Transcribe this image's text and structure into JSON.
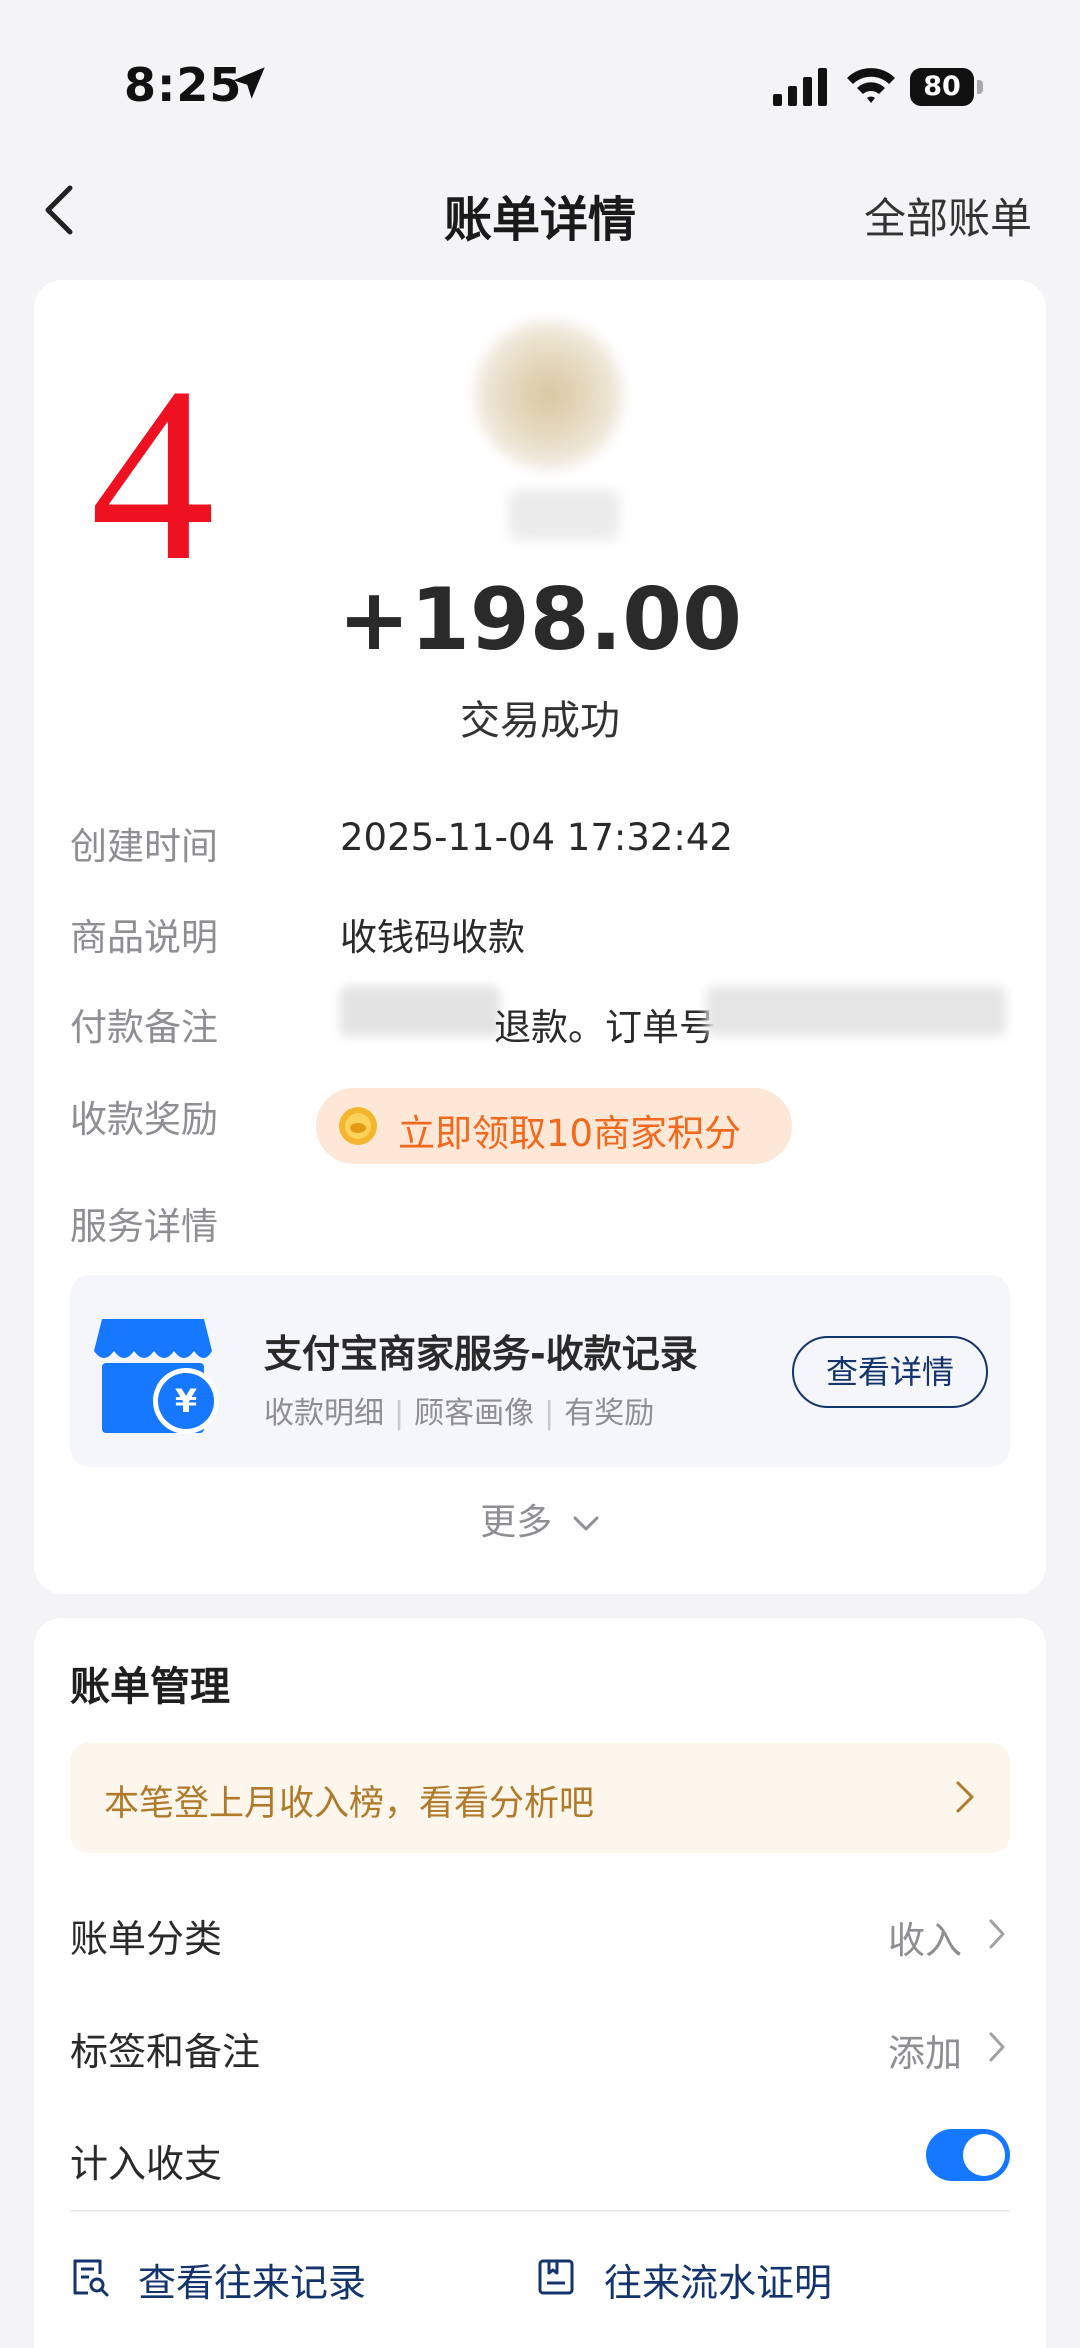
{
  "status_bar": {
    "time": "8:25",
    "battery": "80",
    "icons": [
      "location-arrow-icon",
      "cellular-signal-icon",
      "wifi-icon",
      "battery-icon"
    ]
  },
  "nav": {
    "title": "账单详情",
    "right_link": "全部账单",
    "back_icon": "chevron-left-icon"
  },
  "overlay_number": "4",
  "transaction": {
    "amount": "+198.00",
    "status": "交易成功"
  },
  "details": {
    "created_label": "创建时间",
    "created_value": "2025-11-04 17:32:42",
    "product_label": "商品说明",
    "product_value": "收钱码收款",
    "remark_label": "付款备注",
    "remark_mid": "退款。订单号",
    "reward_label": "收款奖励",
    "reward_text": "立即领取10商家积分",
    "service_label": "服务详情"
  },
  "service": {
    "title": "支付宝商家服务-收款记录",
    "tags": [
      "收款明细",
      "顾客画像",
      "有奖励"
    ],
    "button": "查看详情"
  },
  "more": "更多",
  "management": {
    "title": "账单管理",
    "banner": "本笔登上月收入榜，看看分析吧",
    "category_label": "账单分类",
    "category_value": "收入",
    "tags_label": "标签和备注",
    "tags_value": "添加",
    "include_label": "计入收支",
    "include_on": true,
    "link_records": "查看往来记录",
    "link_proof": "往来流水证明"
  },
  "colors": {
    "accent_blue": "#1677ff",
    "link_navy": "#14346d",
    "reward_orange": "#f0691d",
    "overlay_red": "#ee1122",
    "banner_gold": "#b07a2a"
  }
}
